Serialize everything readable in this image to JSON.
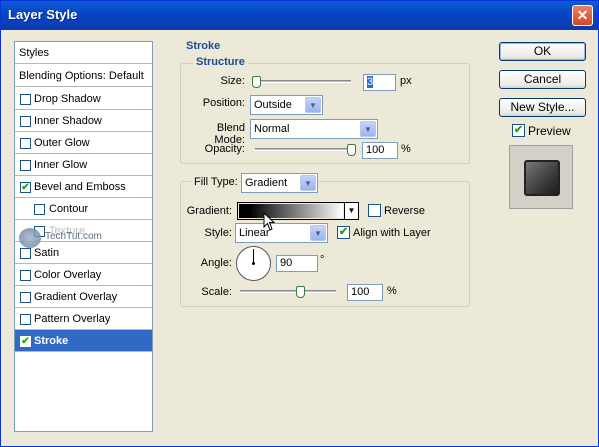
{
  "window": {
    "title": "Layer Style",
    "close_glyph": "✕"
  },
  "styles_list": {
    "header": "Styles",
    "blending": "Blending Options: Default",
    "items": [
      {
        "label": "Drop Shadow",
        "checked": false
      },
      {
        "label": "Inner Shadow",
        "checked": false
      },
      {
        "label": "Outer Glow",
        "checked": false
      },
      {
        "label": "Inner Glow",
        "checked": false
      },
      {
        "label": "Bevel and Emboss",
        "checked": true
      },
      {
        "label": "Contour",
        "checked": false
      },
      {
        "label": "Texture",
        "checked": false
      },
      {
        "label": "Satin",
        "checked": false
      },
      {
        "label": "Color Overlay",
        "checked": false
      },
      {
        "label": "Gradient Overlay",
        "checked": false
      },
      {
        "label": "Pattern Overlay",
        "checked": false
      },
      {
        "label": "Stroke",
        "checked": true
      }
    ],
    "check_glyph": "✔",
    "watermark": "TechTut.com"
  },
  "stroke": {
    "title": "Stroke",
    "structure": {
      "title": "Structure",
      "size_label": "Size:",
      "size_value": "3",
      "size_unit": "px",
      "position_label": "Position:",
      "position_value": "Outside",
      "blend_label": "Blend Mode:",
      "blend_value": "Normal",
      "opacity_label": "Opacity:",
      "opacity_value": "100",
      "opacity_unit": "%"
    },
    "fill": {
      "fill_type_label": "Fill Type:",
      "fill_type_value": "Gradient",
      "gradient_label": "Gradient:",
      "reverse_label": "Reverse",
      "reverse_checked": false,
      "style_label": "Style:",
      "style_value": "Linear",
      "align_label": "Align with Layer",
      "align_checked": true,
      "angle_label": "Angle:",
      "angle_value": "90",
      "angle_unit": "°",
      "scale_label": "Scale:",
      "scale_value": "100",
      "scale_unit": "%"
    }
  },
  "buttons": {
    "ok": "OK",
    "cancel": "Cancel",
    "new_style": "New Style...",
    "preview_label": "Preview",
    "preview_checked": true
  },
  "glyphs": {
    "dropdown": "▼",
    "check": "✔"
  }
}
